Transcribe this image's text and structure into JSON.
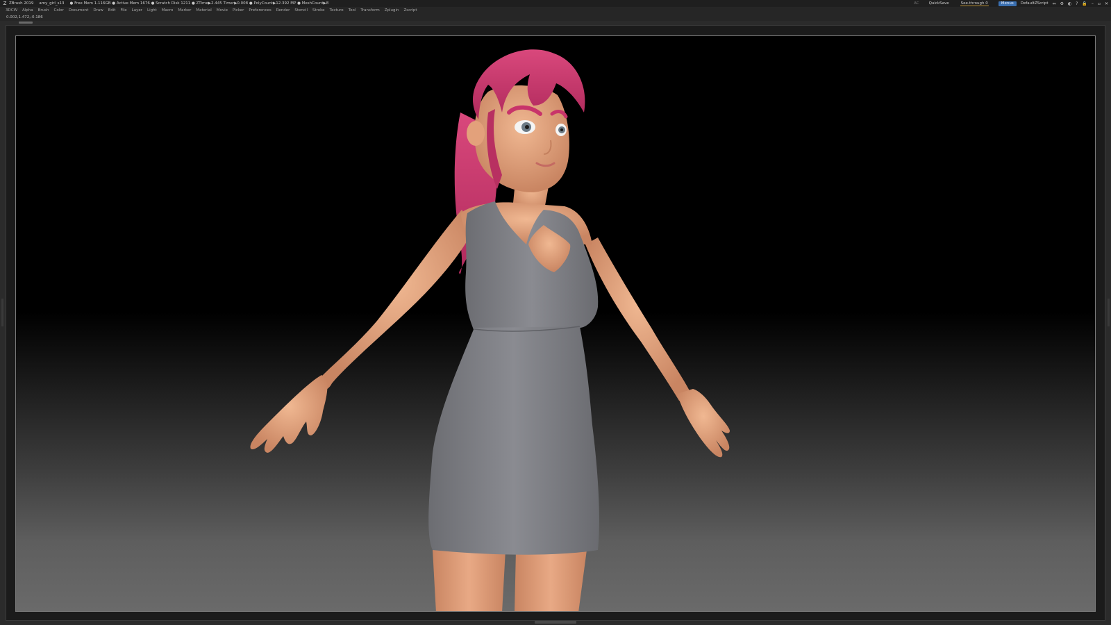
{
  "titlebar": {
    "app_name": "ZBrush 2019",
    "file_name": "amy_girl_s13",
    "stats": "● Free Mem 1.116GB ● Active Mem 1676 ● Scratch Disk 1211 ● ZTime▶2.445 Timer▶0.008 ● PolyCount▶12.392 MP ● MeshCount▶8",
    "ac": "AC",
    "quicksave": "QuickSave",
    "see_through": "See-through  0",
    "menus": "Menus",
    "script": "DefaultZScript"
  },
  "menubar": {
    "items": [
      "3DCW",
      "Alpha",
      "Brush",
      "Color",
      "Document",
      "Draw",
      "Edit",
      "File",
      "Layer",
      "Light",
      "Macro",
      "Marker",
      "Material",
      "Movie",
      "Picker",
      "Preferences",
      "Render",
      "Stencil",
      "Stroke",
      "Texture",
      "Tool",
      "Transform",
      "Zplugin",
      "Zscript"
    ]
  },
  "info": {
    "coords": "0.002,1.472,-0.186"
  },
  "colors": {
    "hair": "#c8346a",
    "skin": "#e0a07a",
    "dress": "#7d7e83",
    "accent_blue": "#3a6fb0"
  }
}
